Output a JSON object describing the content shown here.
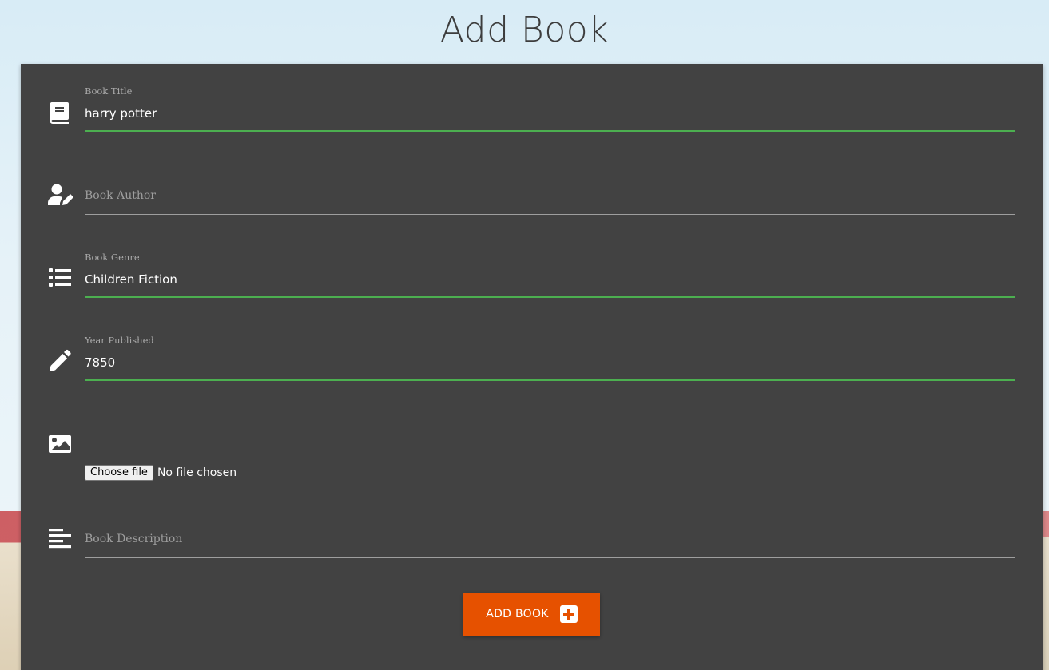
{
  "page": {
    "title": "Add Book"
  },
  "form": {
    "title_field": {
      "label": "Book Title",
      "value": "harry potter",
      "icon": "book-icon"
    },
    "author_field": {
      "placeholder": "Book Author",
      "value": "",
      "icon": "user-edit-icon"
    },
    "genre_field": {
      "label": "Book Genre",
      "value": "Children Fiction",
      "icon": "list-icon"
    },
    "year_field": {
      "label": "Year Published",
      "value": "7850",
      "icon": "pencil-icon"
    },
    "image_field": {
      "button_label": "Choose file",
      "status": "No file chosen",
      "icon": "image-icon"
    },
    "description_field": {
      "placeholder": "Book Description",
      "value": "",
      "icon": "align-left-icon"
    },
    "submit": {
      "label": "ADD BOOK",
      "icon": "plus-square-icon"
    }
  },
  "colors": {
    "card_background": "#424242",
    "active_underline": "#4caf50",
    "button": "#e65100"
  }
}
